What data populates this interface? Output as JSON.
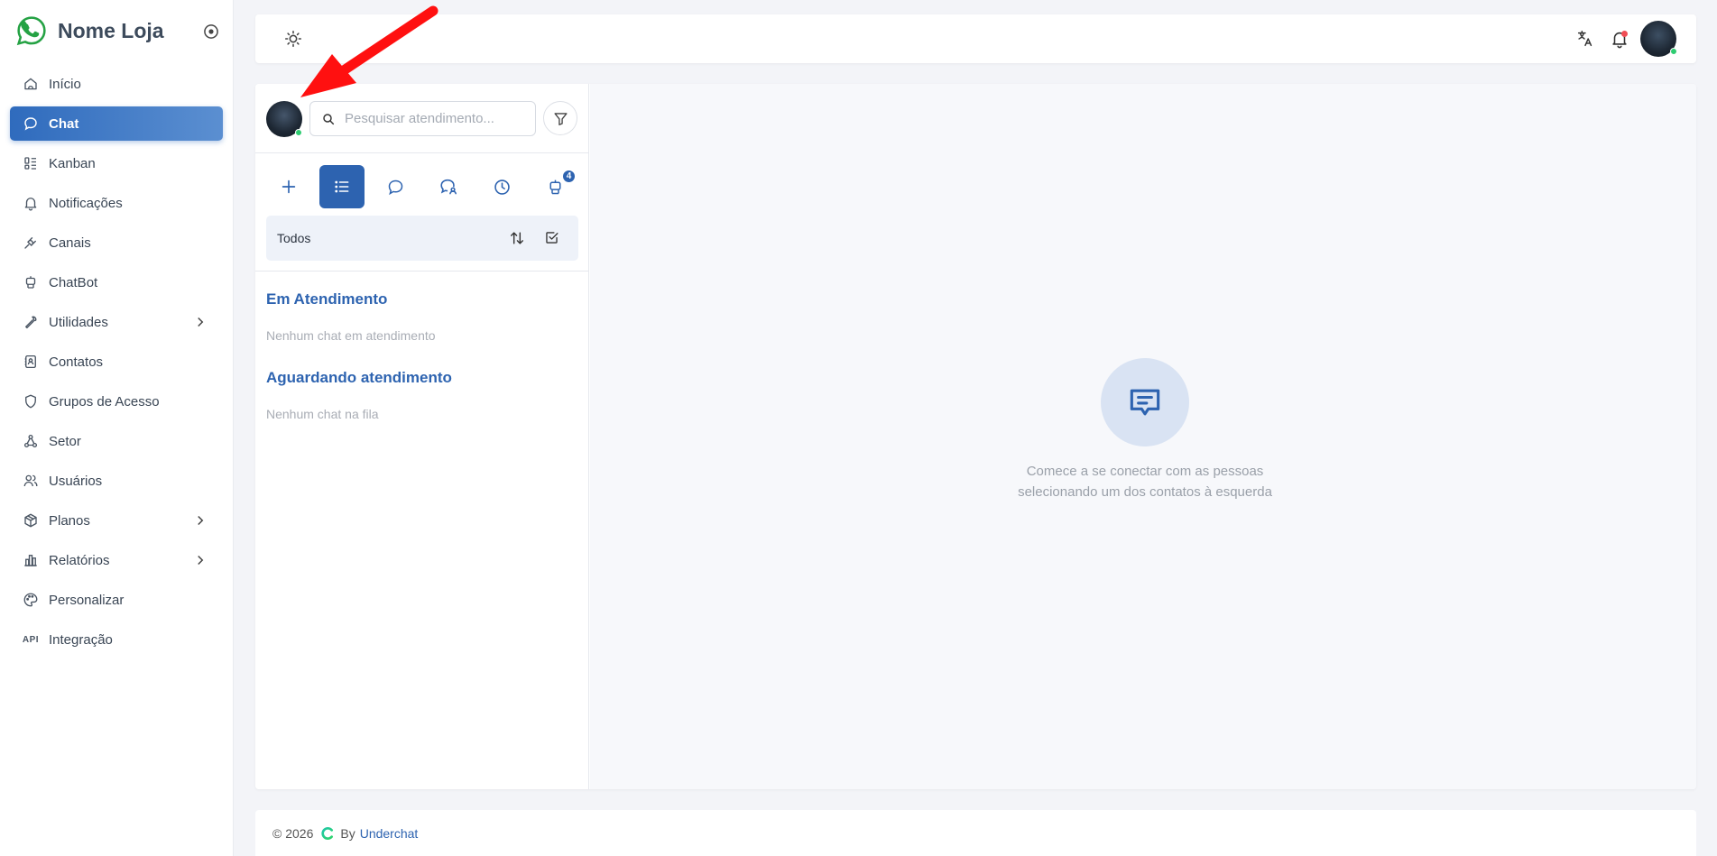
{
  "brand": {
    "name": "Nome Loja"
  },
  "sidebar": {
    "items": [
      {
        "label": "Início",
        "icon": "home-icon"
      },
      {
        "label": "Chat",
        "icon": "chat-icon",
        "active": true
      },
      {
        "label": "Kanban",
        "icon": "kanban-icon"
      },
      {
        "label": "Notificações",
        "icon": "bell-icon"
      },
      {
        "label": "Canais",
        "icon": "plug-icon"
      },
      {
        "label": "ChatBot",
        "icon": "robot-icon"
      },
      {
        "label": "Utilidades",
        "icon": "wrench-icon",
        "expandable": true
      },
      {
        "label": "Contatos",
        "icon": "contacts-icon"
      },
      {
        "label": "Grupos de Acesso",
        "icon": "shield-icon"
      },
      {
        "label": "Setor",
        "icon": "sitemap-icon"
      },
      {
        "label": "Usuários",
        "icon": "users-icon"
      },
      {
        "label": "Planos",
        "icon": "package-icon",
        "expandable": true
      },
      {
        "label": "Relatórios",
        "icon": "bar-chart-icon",
        "expandable": true
      },
      {
        "label": "Personalizar",
        "icon": "palette-icon"
      },
      {
        "label": "Integração",
        "icon": "api-icon",
        "icon_text": "API"
      }
    ]
  },
  "chat": {
    "search_placeholder": "Pesquisar atendimento...",
    "tabs": [
      {
        "icon": "plus-icon"
      },
      {
        "icon": "list-icon",
        "active": true
      },
      {
        "icon": "message-circle-icon"
      },
      {
        "icon": "user-chat-icon"
      },
      {
        "icon": "clock-icon"
      },
      {
        "icon": "robot-icon",
        "badge": "4"
      }
    ],
    "filter_label": "Todos",
    "sections": [
      {
        "title": "Em Atendimento",
        "empty": "Nenhum chat em atendimento"
      },
      {
        "title": "Aguardando atendimento",
        "empty": "Nenhum chat na fila"
      }
    ],
    "empty_state": {
      "line1": "Comece a se conectar com as pessoas",
      "line2": "selecionando um dos contatos à esquerda"
    }
  },
  "footer": {
    "copyright": "© 2026",
    "by": "By",
    "link": "Underchat"
  },
  "colors": {
    "accent": "#2d63b0",
    "online": "#2ecc71",
    "notification": "#f04d55",
    "brand_logo": "#25a244"
  }
}
